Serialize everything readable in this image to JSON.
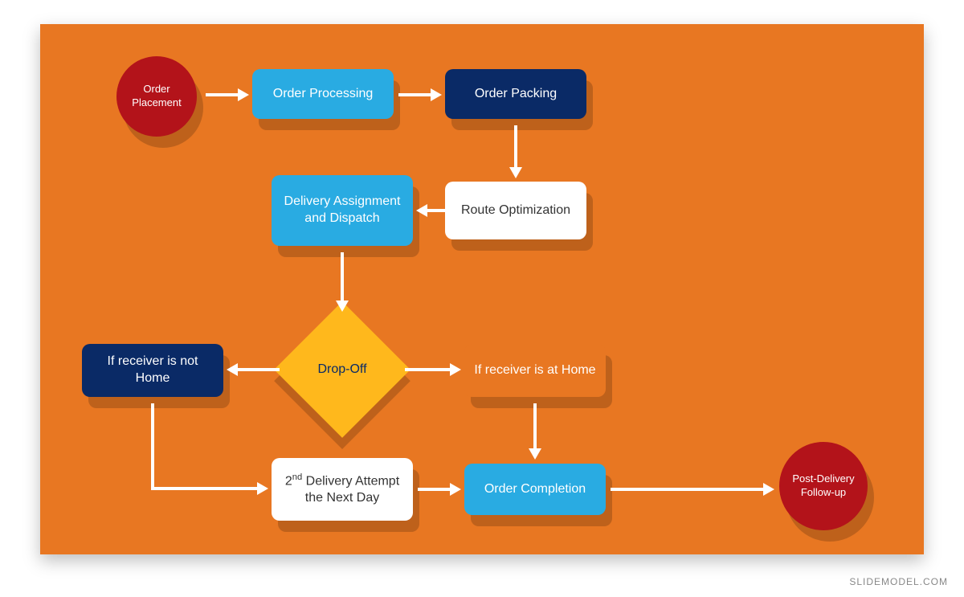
{
  "watermark": "SLIDEMODEL.COM",
  "colors": {
    "bg": "#E87722",
    "red": "#B3131A",
    "lightBlue": "#29ABE2",
    "navy": "#0A2A66",
    "white": "#FFFFFF",
    "orange": "#E87722",
    "yellow": "#FFB81C"
  },
  "nodes": {
    "orderPlacement": "Order Placement",
    "orderProcessing": "Order Processing",
    "orderPacking": "Order Packing",
    "routeOptimization": "Route Optimization",
    "deliveryAssignment": "Delivery Assignment and Dispatch",
    "dropOff": "Drop-Off",
    "receiverNotHome": "If receiver is not Home",
    "receiverAtHome": "If receiver is at Home",
    "secondAttempt_prefix": "2",
    "secondAttempt_sup": "nd",
    "secondAttempt_rest": " Delivery Attempt the Next Day",
    "orderCompletion": "Order Completion",
    "postDelivery": "Post-Delivery Follow-up"
  }
}
